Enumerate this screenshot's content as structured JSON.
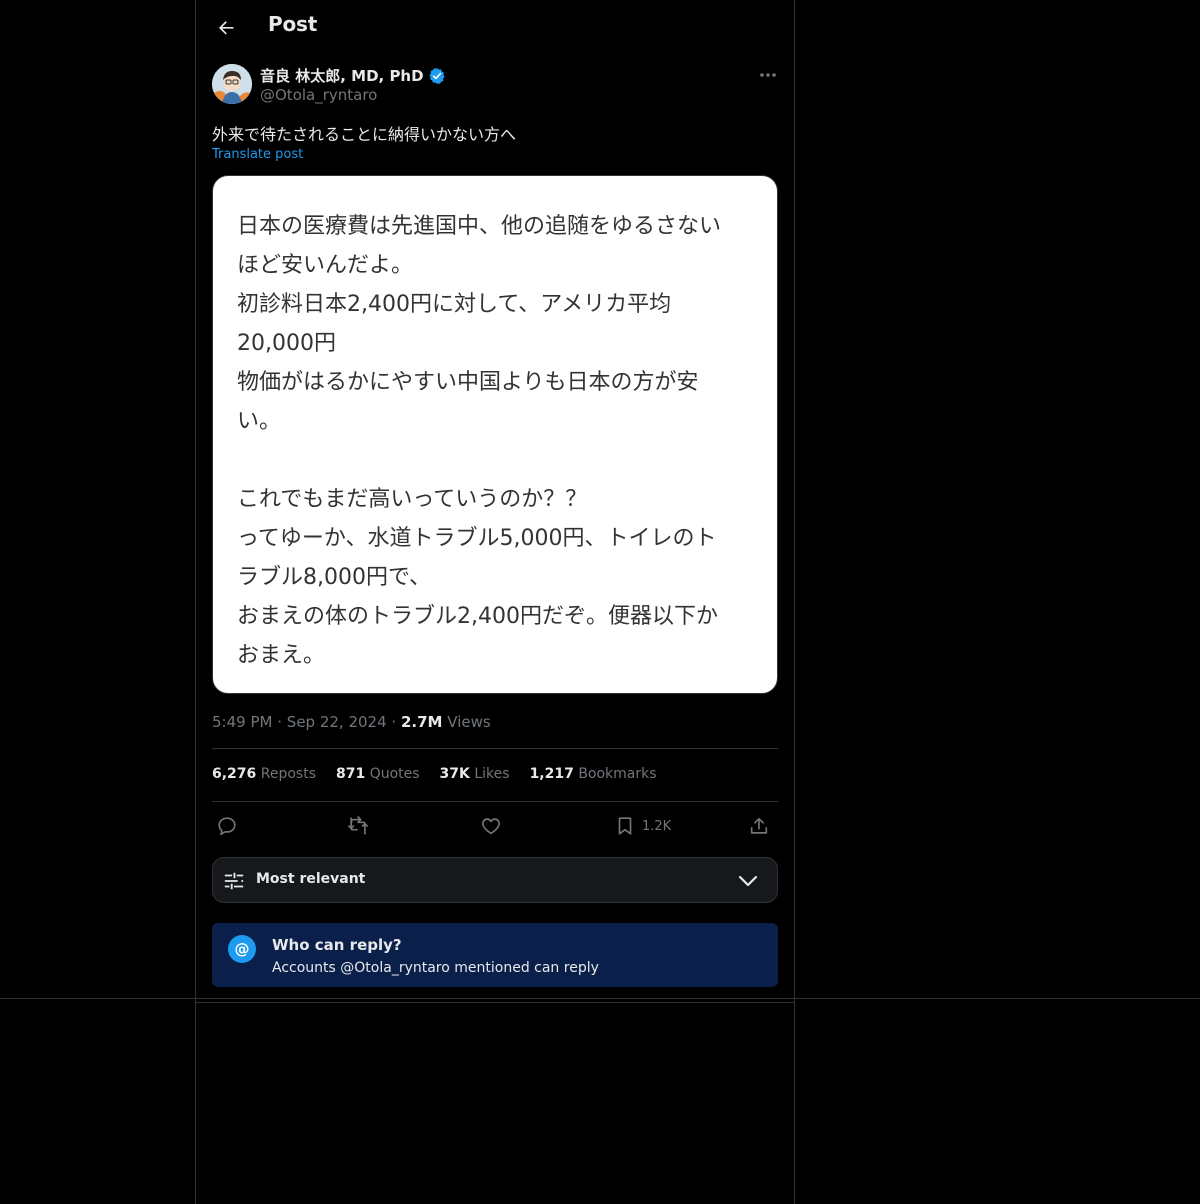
{
  "header": {
    "title": "Post"
  },
  "author": {
    "name": "音良 林太郎, MD, PhD",
    "handle": "@Otola_ryntaro"
  },
  "post": {
    "text": "外来で待たされることに納得いかない方へ",
    "translate_label": "Translate post",
    "image_lines": [
      "日本の医療費は先進国中、他の追随をゆるさない",
      "ほど安いんだよ。",
      "初診料日本2,400円に対して、アメリカ平均",
      "20,000円",
      "物価がはるかにやすい中国よりも日本の方が安",
      "い。",
      "",
      "これでもまだ高いっていうのか？？",
      "ってゆーか、水道トラブル5,000円、トイレのト",
      "ラブル8,000円で、",
      "おまえの体のトラブル2,400円だぞ。便器以下か",
      "おまえ。"
    ],
    "time": "5:49 PM",
    "dot": "·",
    "date": "Sep 22, 2024",
    "views_count": "2.7M",
    "views_label": "Views"
  },
  "stats": {
    "reposts_count": "6,276",
    "reposts_label": "Reposts",
    "quotes_count": "871",
    "quotes_label": "Quotes",
    "likes_count": "37K",
    "likes_label": "Likes",
    "bookmarks_count": "1,217",
    "bookmarks_label": "Bookmarks"
  },
  "actions": {
    "bookmark_count": "1.2K"
  },
  "icons": [
    "back-arrow-icon",
    "verified-badge-icon",
    "more-icon",
    "reply-icon",
    "repost-icon",
    "like-icon",
    "bookmark-icon",
    "share-icon",
    "sliders-icon",
    "chevron-down-icon",
    "at-icon"
  ],
  "sort": {
    "label": "Most relevant"
  },
  "reply_restriction": {
    "at_symbol": "@",
    "title": "Who can reply?",
    "subtitle": "Accounts @Otola_ryntaro mentioned can reply"
  },
  "colors": {
    "background": "#000000",
    "text": "#e7e9ea",
    "muted": "#71767b",
    "accent": "#1d9bf0",
    "divider": "#2f3336",
    "reply_box": "#0a1f4a"
  }
}
